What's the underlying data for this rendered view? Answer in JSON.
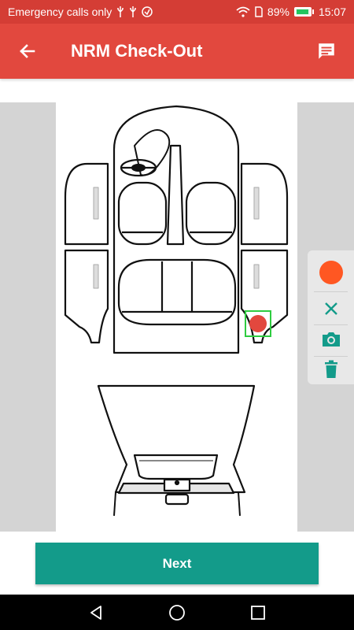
{
  "status_bar": {
    "left_text": "Emergency calls only",
    "battery": "89%",
    "time": "15:07",
    "icons": [
      "usb-icon",
      "usb-icon",
      "shield-icon",
      "wifi-icon",
      "sim-icon",
      "battery-icon"
    ]
  },
  "app_bar": {
    "title": "NRM Check-Out",
    "back_icon": "arrow-left-icon",
    "action_icon": "message-icon"
  },
  "toolbar": {
    "selected_color": "#ff5722",
    "tools": [
      "color-picker",
      "close-icon",
      "camera-icon",
      "trash-icon"
    ]
  },
  "marker": {
    "color": "#e2483e"
  },
  "footer": {
    "next_label": "Next"
  },
  "colors": {
    "status_bar": "#d43d35",
    "app_bar": "#e2483e",
    "primary_button": "#139b8a",
    "tool_icons": "#139b8a"
  }
}
